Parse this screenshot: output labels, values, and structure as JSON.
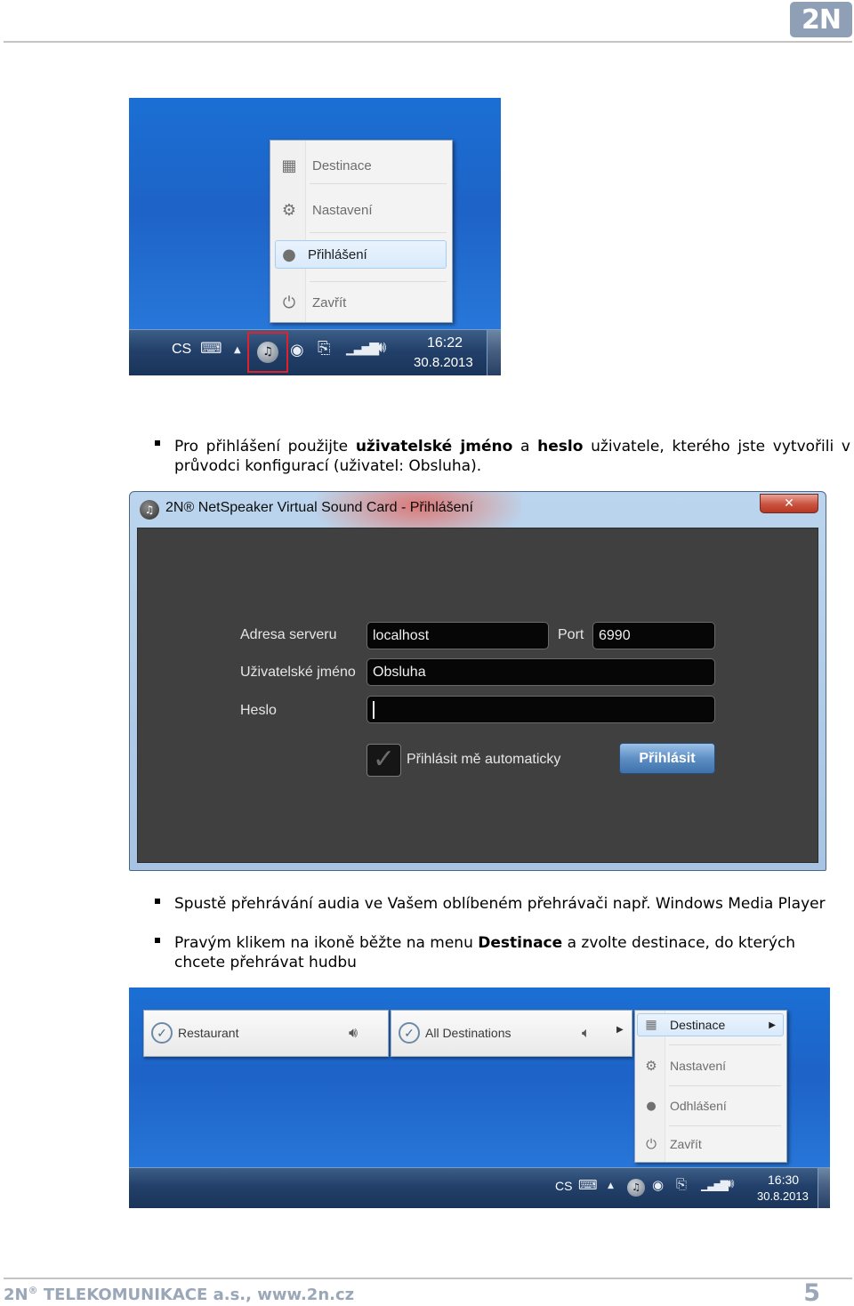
{
  "header": {
    "logo": "2N"
  },
  "shot1": {
    "menu": [
      {
        "label": "Destinace",
        "icon": "destinations-icon",
        "active": false
      },
      {
        "label": "Nastavení",
        "icon": "gears-icon",
        "active": false
      },
      {
        "label": "Přihlášení",
        "icon": "user-icon",
        "active": true
      },
      {
        "label": "Zavřít",
        "icon": "power-icon",
        "active": false
      }
    ],
    "tray": {
      "lang": "CS",
      "time": "16:22",
      "date": "30.8.2013"
    }
  },
  "bullets1": [
    {
      "html": "Pro přihlášení použijte <b>uživatelské jméno</b> a <b>heslo</b> uživatele, kterého jste vytvořili v průvodci konfigurací (uživatel: Obsluha)."
    }
  ],
  "login": {
    "title": "2N® NetSpeaker Virtual Sound Card - Přihlášení",
    "server_label": "Adresa serveru",
    "server_value": "localhost",
    "port_label": "Port",
    "port_value": "6990",
    "user_label": "Uživatelské jméno",
    "user_value": "Obsluha",
    "password_label": "Heslo",
    "password_value": "",
    "auto_label": "Přihlásit mě automaticky",
    "button": "Přihlásit"
  },
  "bullets2": [
    {
      "html": "Spustě přehrávání audia ve Vašem oblíbeném přehrávači např. Windows Media Player"
    },
    {
      "html": "Pravým klikem na ikoně běžte na menu <b>Destinace</b> a zvolte destinace, do kterých chcete přehrávat hudbu"
    }
  ],
  "shot2": {
    "tiles": [
      "Restaurant",
      "All Destinations"
    ],
    "menu": [
      "Destinace",
      "Nastavení",
      "Odhlášení",
      "Zavřít"
    ],
    "tray": {
      "lang": "CS",
      "time": "16:30",
      "date": "30.8.2013"
    }
  },
  "footer": {
    "company": "2N",
    "reg": "®",
    "rest": " TELEKOMUNIKACE a.s., www.2n.cz",
    "page": "5"
  }
}
